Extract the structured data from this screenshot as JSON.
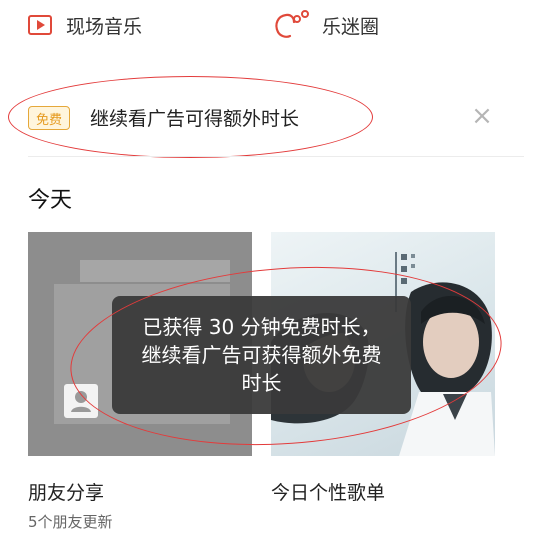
{
  "quick_links": [
    {
      "label": "现场音乐",
      "icon": "play-box-icon"
    },
    {
      "label": "乐迷圈",
      "icon": "chat-bubble-icon"
    }
  ],
  "banner": {
    "badge": "免费",
    "text": "继续看广告可得额外时长",
    "close_glyph": "×"
  },
  "section": {
    "title": "今天"
  },
  "cards": [
    {
      "caption": "朋友分享",
      "subtitle": "5个朋友更新"
    },
    {
      "caption": "今日个性歌单"
    }
  ],
  "toast": {
    "message": "已获得 30 分钟免费时长，继续看广告可获得额外免费时长"
  },
  "colors": {
    "accent_red": "#e0493a",
    "badge_orange": "#e59a1f",
    "annotation_red": "#e33b3b"
  }
}
